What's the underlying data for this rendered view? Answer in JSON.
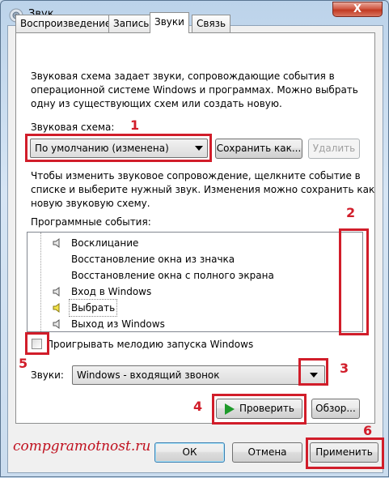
{
  "window": {
    "title": "Звук",
    "close_label": "X"
  },
  "tabs": [
    {
      "label": "Воспроизведение",
      "active": false
    },
    {
      "label": "Запись",
      "active": false
    },
    {
      "label": "Звуки",
      "active": true
    },
    {
      "label": "Связь",
      "active": false
    }
  ],
  "sounds_tab": {
    "intro_lines": [
      "Звуковая схема задает звуки, сопровождающие события в",
      "операционной системе Windows и программах. Можно выбрать",
      "одну из существующих схем или создать новую."
    ],
    "scheme_label": "Звуковая схема:",
    "scheme_value": "По умолчанию (изменена)",
    "save_as_label": "Сохранить как...",
    "delete_label": "Удалить",
    "change_lines": [
      "Чтобы изменить звуковое сопровождение, щелкните событие в",
      "списке и выберите нужный звук. Изменения можно сохранить как",
      "новую звуковую схему."
    ],
    "events_label": "Программные события:",
    "events": [
      {
        "label": "Восклицание",
        "has_sound": true,
        "selected": false
      },
      {
        "label": "Восстановление окна из значка",
        "has_sound": false,
        "selected": false
      },
      {
        "label": "Восстановление окна с полного экрана",
        "has_sound": false,
        "selected": false
      },
      {
        "label": "Вход в Windows",
        "has_sound": true,
        "selected": false
      },
      {
        "label": "Выбрать",
        "has_sound": true,
        "selected": true
      },
      {
        "label": "Выход из Windows",
        "has_sound": true,
        "selected": false
      }
    ],
    "startup_checkbox_label": "Проигрывать мелодию запуска Windows",
    "startup_checked": false,
    "sounds_label": "Звуки:",
    "sound_value": "Windows - входящий звонок",
    "test_label": "Проверить",
    "browse_label": "Обзор..."
  },
  "footer": {
    "ok_label": "ОК",
    "cancel_label": "Отмена",
    "apply_label": "Применить"
  },
  "annotations": {
    "numbers": [
      "1",
      "2",
      "3",
      "4",
      "5",
      "6"
    ],
    "watermark": "compgramotnost.ru",
    "color": "#d11d2a"
  }
}
